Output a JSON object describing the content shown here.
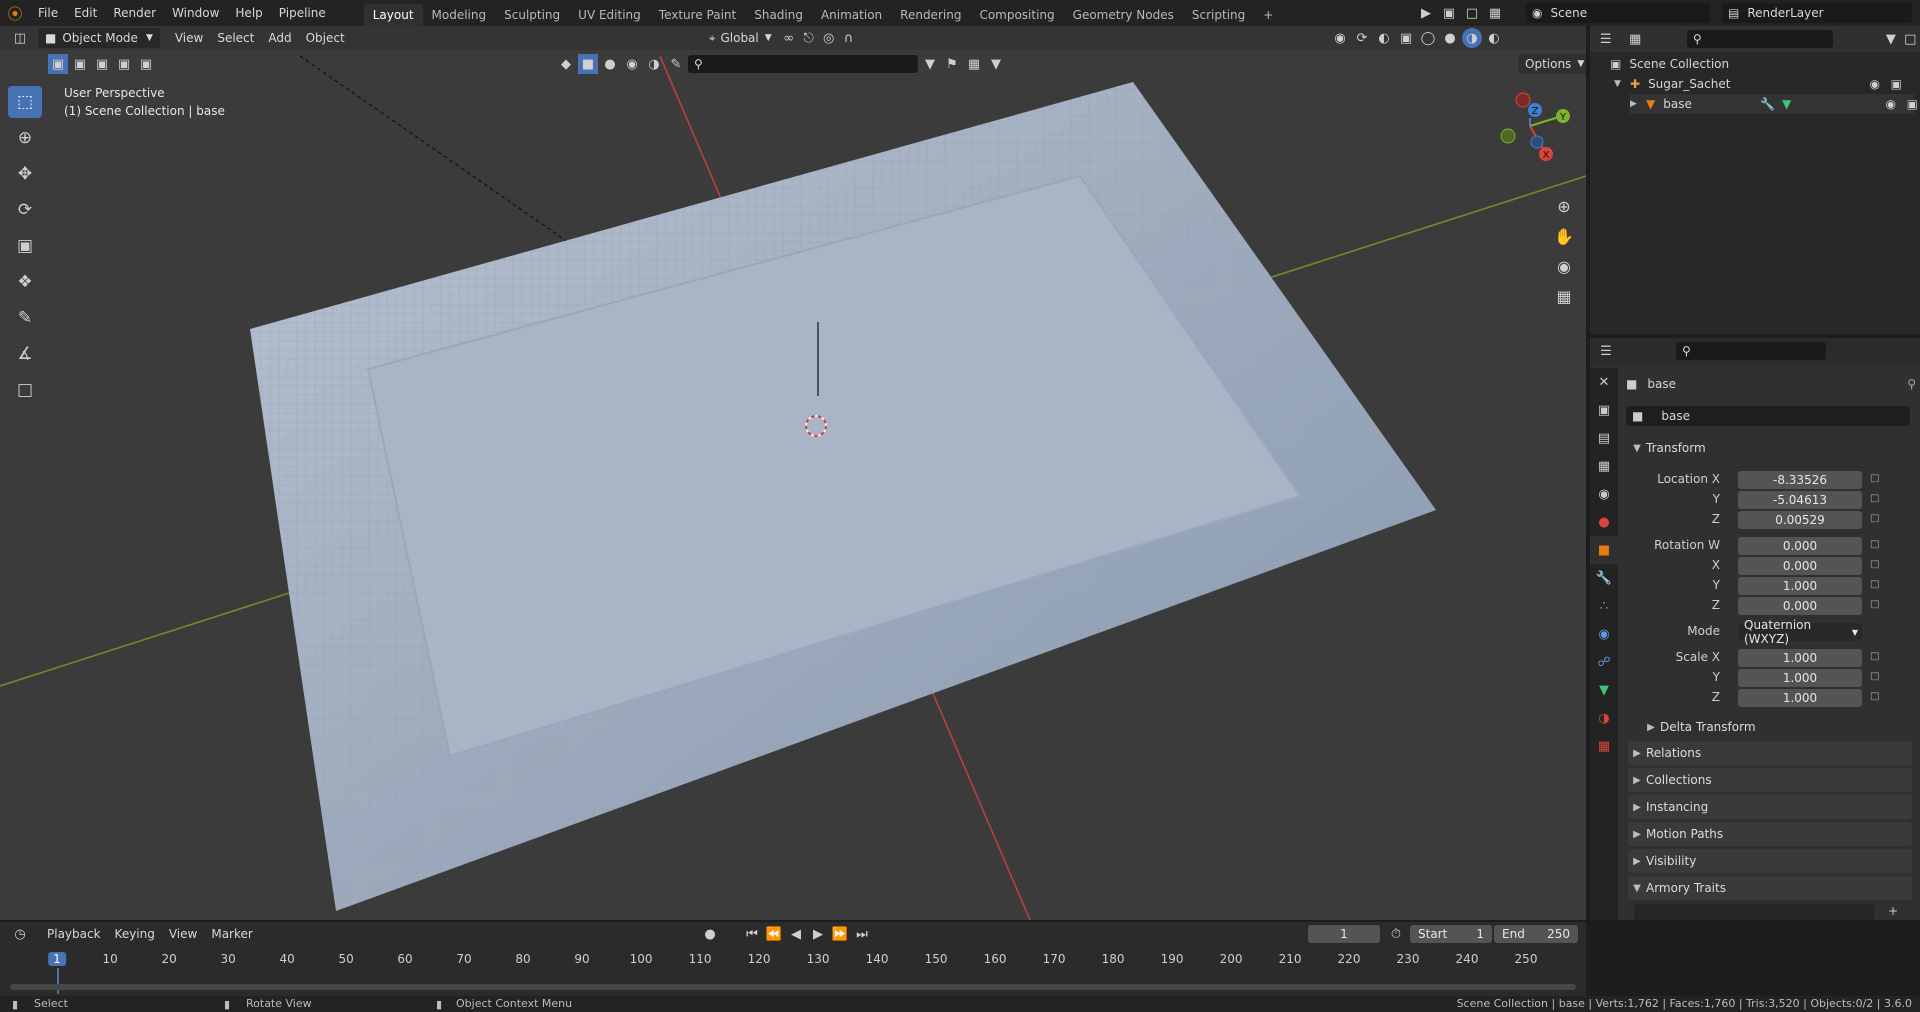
{
  "topbar": {
    "menus": [
      "File",
      "Edit",
      "Render",
      "Window",
      "Help",
      "Pipeline"
    ],
    "workspaces": [
      "Layout",
      "Modeling",
      "Sculpting",
      "UV Editing",
      "Texture Paint",
      "Shading",
      "Animation",
      "Rendering",
      "Compositing",
      "Geometry Nodes",
      "Scripting"
    ],
    "active_workspace": "Layout",
    "scene_name": "Scene",
    "render_layer": "RenderLayer"
  },
  "viewport": {
    "mode": "Object Mode",
    "menus": [
      "View",
      "Select",
      "Add",
      "Object"
    ],
    "orientation": "Global",
    "options_label": "Options",
    "overlay_line1": "User Perspective",
    "overlay_line2": "(1) Scene Collection | base",
    "gizmo_x": "X",
    "gizmo_y": "Y",
    "gizmo_z": "Z"
  },
  "outliner": {
    "root": "Scene Collection",
    "items": [
      {
        "label": "Sugar_Sachet"
      },
      {
        "label": "base"
      }
    ]
  },
  "properties": {
    "object_name": "base",
    "data_name": "base",
    "transform_label": "Transform",
    "location": {
      "label_x": "Location X",
      "label_y": "Y",
      "label_z": "Z",
      "x": "-8.33526",
      "y": "-5.04613",
      "z": "0.00529"
    },
    "rotation": {
      "label_w": "Rotation W",
      "label_x": "X",
      "label_y": "Y",
      "label_z": "Z",
      "w": "0.000",
      "x": "0.000",
      "y": "1.000",
      "z": "0.000"
    },
    "mode_label": "Mode",
    "mode_value": "Quaternion (WXYZ)",
    "scale": {
      "label_x": "Scale X",
      "label_y": "Y",
      "label_z": "Z",
      "x": "1.000",
      "y": "1.000",
      "z": "1.000"
    },
    "panels": [
      "Delta Transform",
      "Relations",
      "Collections",
      "Instancing",
      "Motion Paths",
      "Visibility",
      "Armory Traits"
    ]
  },
  "timeline": {
    "menus": [
      "Playback",
      "Keying",
      "View",
      "Marker"
    ],
    "current_frame": "1",
    "start_label": "Start",
    "start_value": "1",
    "end_label": "End",
    "end_value": "250",
    "ticks": [
      "1",
      "10",
      "20",
      "30",
      "40",
      "50",
      "60",
      "70",
      "80",
      "90",
      "100",
      "110",
      "120",
      "130",
      "140",
      "150",
      "160",
      "170",
      "180",
      "190",
      "200",
      "210",
      "220",
      "230",
      "240",
      "250"
    ]
  },
  "statusbar": {
    "select": "Select",
    "rotate": "Rotate View",
    "context": "Object Context Menu",
    "stats": "Scene Collection | base | Verts:1,762 | Faces:1,760 | Tris:3,520 | Objects:0/2 | 3.6.0"
  },
  "colors": {
    "accent": "#4772b3",
    "orange": "#e87d0d",
    "x_axis": "#d9453c",
    "y_axis": "#7fb32b",
    "z_axis": "#3f7fd6"
  }
}
